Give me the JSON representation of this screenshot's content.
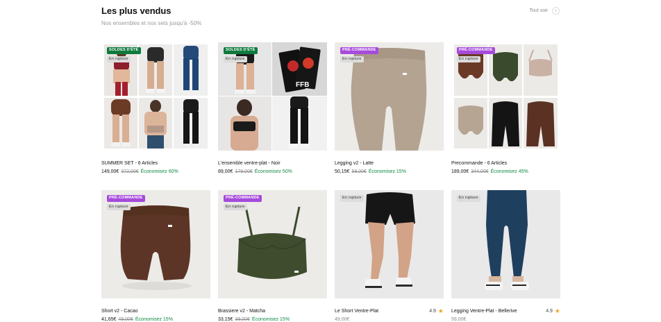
{
  "section": {
    "title": "Les plus vendus",
    "subtitle": "Nos ensembles et nos sets jusqu'à -50%",
    "see_all": "Tout voir",
    "see_all_icon": "›"
  },
  "products": [
    {
      "name": "SUMMER SET - 6 Articles",
      "price": "149,00€",
      "old_price": "372,00€",
      "savings": "Économisez 60%",
      "badge": "SOLDES D'ÉTÉ",
      "badge_color": "#0e7a3d",
      "stock": "En rupture"
    },
    {
      "name": "L'ensemble ventre-plat - Noir",
      "price": "89,00€",
      "old_price": "178,00€",
      "savings": "Économisez 50%",
      "badge": "SOLDES D'ÉTÉ",
      "badge_color": "#0e7a3d",
      "stock": "En rupture",
      "book_label": "FFB"
    },
    {
      "name": "Legging v2 - Latte",
      "price": "50,15€",
      "old_price": "58,00€",
      "savings": "Économisez 15%",
      "badge": "PRÉ-COMMANDE",
      "badge_color": "#a64bdc",
      "stock": "En rupture"
    },
    {
      "name": "Precommande - 6 Articles",
      "price": "189,00€",
      "old_price": "344,00€",
      "savings": "Économisez 45%",
      "badge": "PRÉ-COMMANDE",
      "badge_color": "#a64bdc",
      "stock": "En rupture"
    },
    {
      "name": "Short v2 - Cacao",
      "price": "41,65€",
      "old_price": "49,00€",
      "savings": "Économisez 15%",
      "badge": "PRÉ-COMMANDE",
      "badge_color": "#a64bdc",
      "stock": "En rupture"
    },
    {
      "name": "Brassiere v2 - Matcha",
      "price": "33,15€",
      "old_price": "39,00€",
      "savings": "Économisez 15%",
      "badge": "PRÉ-COMMANDE",
      "badge_color": "#a64bdc",
      "stock": "En rupture"
    },
    {
      "name": "Le Short Ventre-Plat",
      "price": "49,00€",
      "rating": "4.9",
      "rating_icon": "star-icon",
      "stock": "En rupture"
    },
    {
      "name": "Legging Ventre-Plat - Bellerive",
      "price": "59,00€",
      "rating": "4.9",
      "rating_icon": "star-icon",
      "stock": "En rupture"
    }
  ],
  "colors": {
    "sale_green": "#0e7a3d",
    "preorder_purple": "#a64bdc",
    "savings_green": "#0e8a44",
    "star": "#f0a426"
  }
}
